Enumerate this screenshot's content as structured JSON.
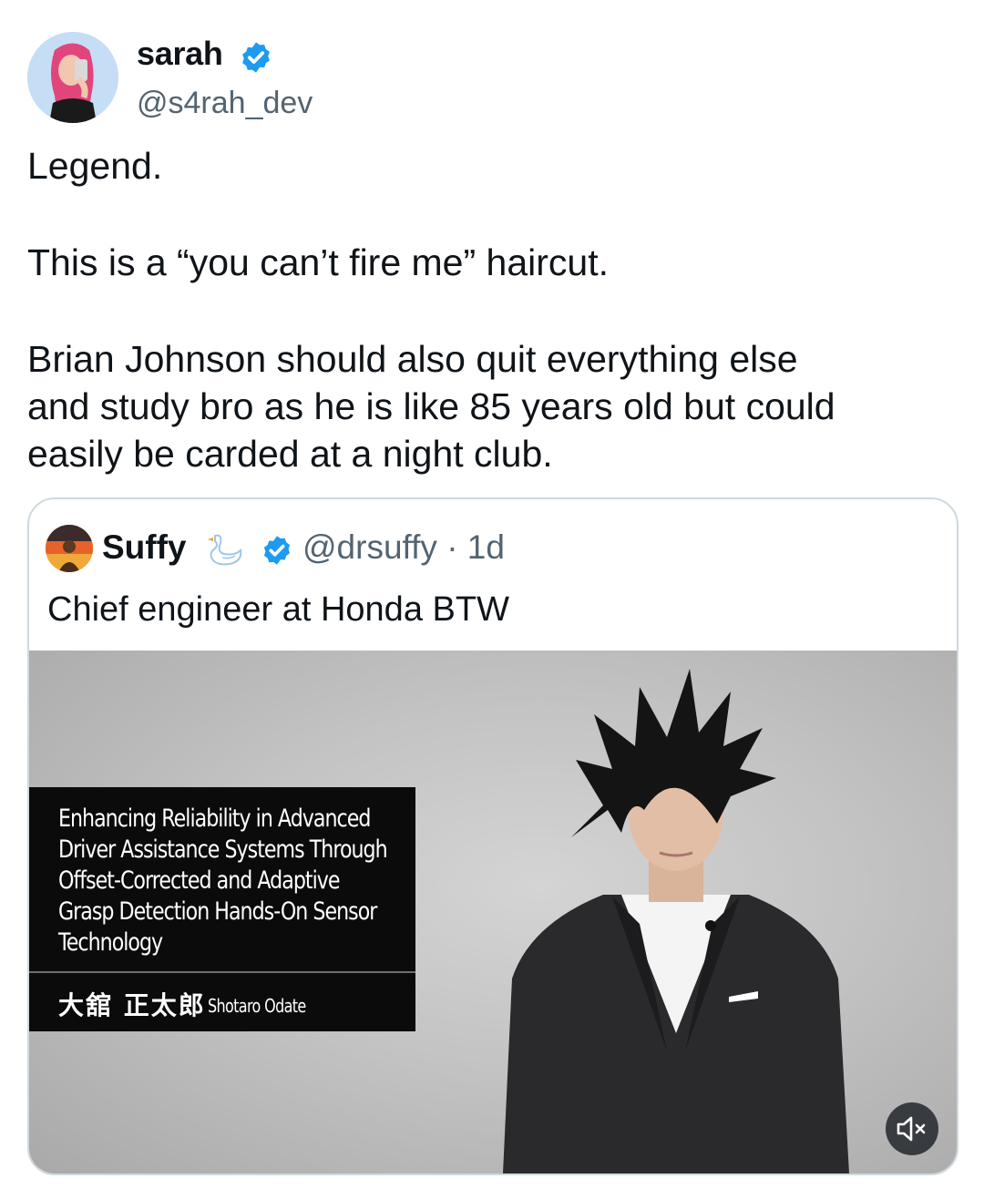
{
  "author": {
    "display_name": "sarah",
    "handle": "@s4rah_dev",
    "verified_icon": "verified-badge-icon",
    "avatar_icon": "avatar"
  },
  "tweet": {
    "line1": "Legend.",
    "line2": "This is a “you can’t fire me” haircut.",
    "line3": "Brian Johnson should also quit everything else",
    "line4": "and study bro as he is like 85 years old but could",
    "line5": "easily be carded at a night club."
  },
  "quote": {
    "display_name": "Suffy",
    "emoji_icon": "swan-icon",
    "handle_time": "@drsuffy · 1d",
    "text": "Chief engineer at Honda BTW",
    "media": {
      "caption_title_lines": [
        "Enhancing Reliability in Advanced",
        "Driver Assistance Systems Through",
        "Offset-Corrected and Adaptive",
        "Grasp Detection Hands-On Sensor",
        "Technology"
      ],
      "caption_name_jp": "大舘 正太郎",
      "caption_name_en": "Shotaro Odate",
      "mute_icon": "speaker-muted-icon"
    }
  },
  "colors": {
    "text_primary": "#0f1419",
    "text_secondary": "#536471",
    "verified_blue": "#1d9bf0",
    "card_border": "#cfd9de"
  }
}
